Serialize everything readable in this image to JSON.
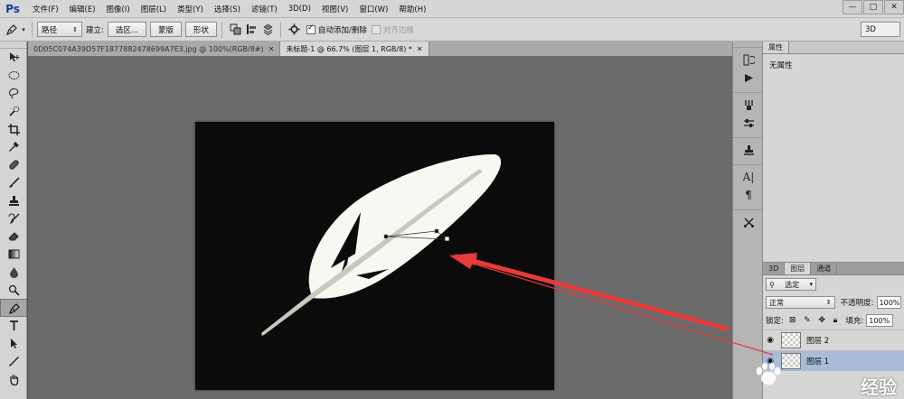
{
  "app": {
    "logo": "Ps",
    "menu": [
      "文件(F)",
      "编辑(E)",
      "图像(I)",
      "图层(L)",
      "类型(Y)",
      "选择(S)",
      "滤镜(T)",
      "3D(D)",
      "视图(V)",
      "窗口(W)",
      "帮助(H)"
    ],
    "window_controls": [
      "—",
      "□",
      "✕"
    ]
  },
  "options": {
    "tool_icon": "pen-icon",
    "mode_value": "路径",
    "make_label": "建立:",
    "selection_btn": "选区...",
    "mask_btn": "蒙版",
    "shape_btn": "形状",
    "auto_add_label": "自动添加/删除",
    "align_edges_label": "对齐边缘",
    "workspace": "3D"
  },
  "tabs": [
    {
      "title": "0D05C074A39D57F1877882478699A7E3.jpg @ 100%(RGB/8#)",
      "active": false
    },
    {
      "title": "未标题-1 @ 66.7% (图层 1, RGB/8) *",
      "active": true
    }
  ],
  "tools": [
    "move-icon",
    "marquee-icon",
    "lasso-icon",
    "quick-select-icon",
    "crop-icon",
    "eyedropper-icon",
    "healing-icon",
    "brush-icon",
    "stamp-icon",
    "history-brush-icon",
    "eraser-icon",
    "gradient-icon",
    "blur-icon",
    "dodge-icon",
    "pen-icon",
    "type-icon",
    "path-select-icon",
    "line-icon",
    "hand-icon"
  ],
  "properties": {
    "tab": "属性",
    "empty_text": "无属性"
  },
  "layers": {
    "tabs": [
      "3D",
      "图层",
      "通道"
    ],
    "filter_label": "选定",
    "blend_mode": "正常",
    "opacity_label": "不透明度:",
    "opacity_value": "100%",
    "lock_label": "锁定:",
    "fill_label": "填充:",
    "fill_value": "100%",
    "items": [
      {
        "name": "图层 2",
        "selected": false
      },
      {
        "name": "图层 1",
        "selected": true
      }
    ]
  },
  "watermark": "经验"
}
